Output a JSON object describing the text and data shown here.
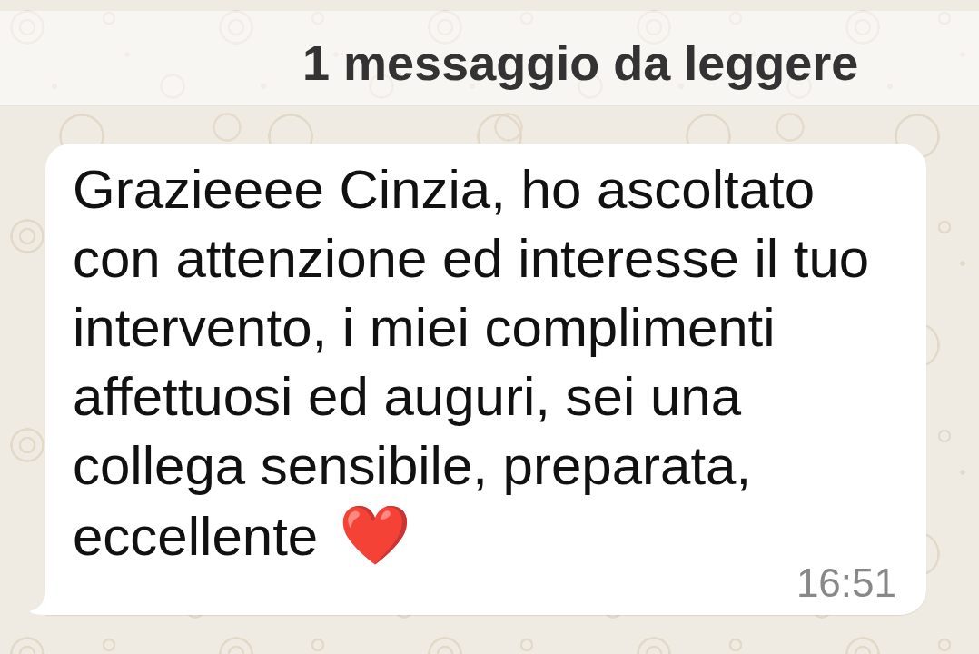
{
  "banner": {
    "text": "1 messaggio da leggere"
  },
  "message": {
    "text": "Grazieeee Cinzia, ho ascoltato con attenzione ed interesse il tuo intervento, i miei complimenti affettuosi ed auguri, sei una collega sensibile, preparata, eccellente",
    "emoji": "❤️",
    "time": "16:51"
  }
}
